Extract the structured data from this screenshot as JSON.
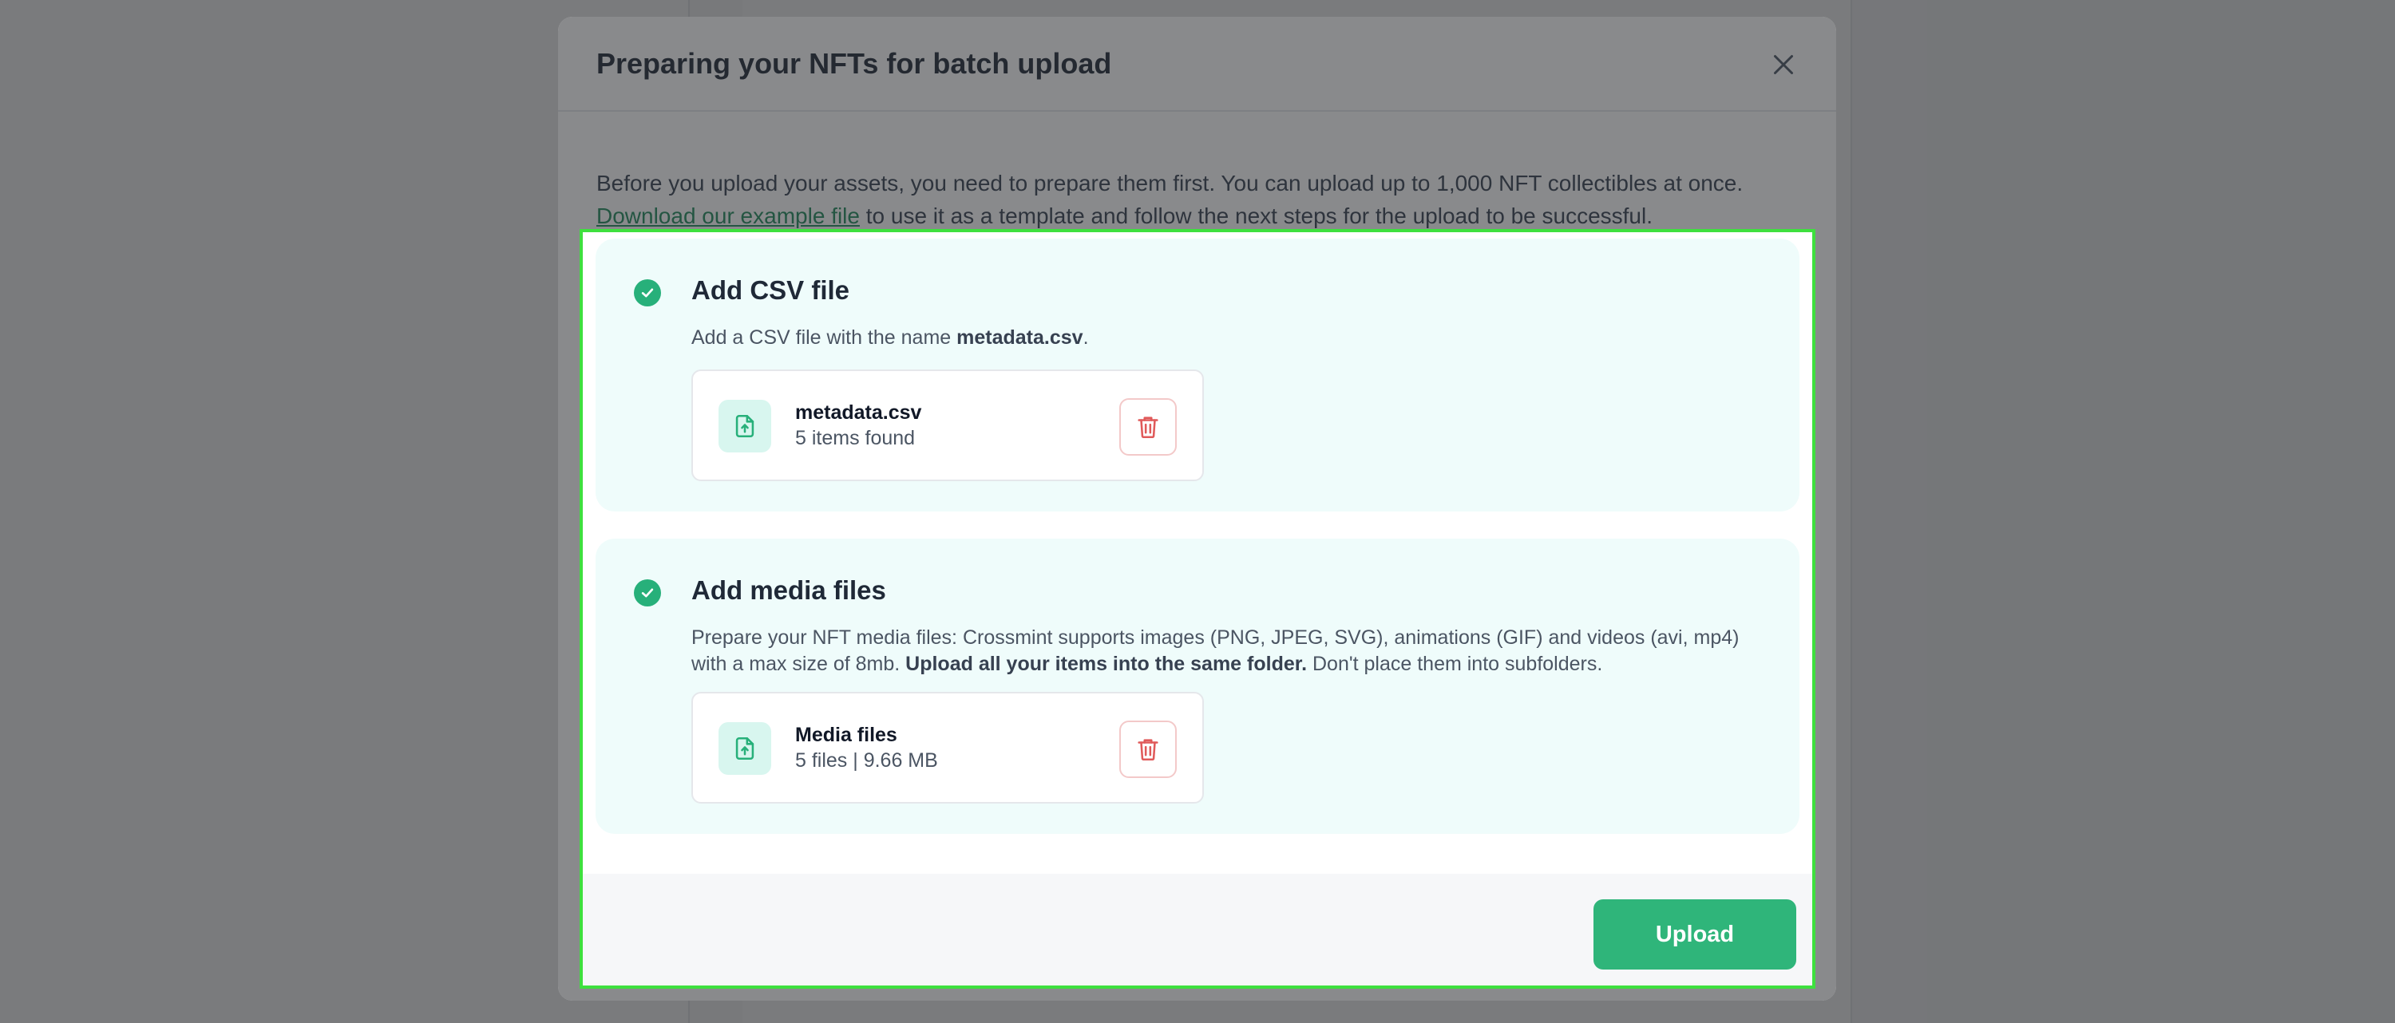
{
  "modal": {
    "title": "Preparing your NFTs for batch upload",
    "intro_before_link": "Before you upload your assets, you need to prepare them first. You can upload up to 1,000 NFT collectibles at once. ",
    "intro_link": "Download our example file",
    "intro_after_link": " to use it as a template and follow the next steps for the upload to be successful."
  },
  "steps": [
    {
      "title": "Add CSV file",
      "desc_before_bold": "Add a CSV file with the name ",
      "desc_bold": "metadata.csv",
      "desc_after_bold": ".",
      "file_name": "metadata.csv",
      "file_meta": "5 items found"
    },
    {
      "title": "Add media files",
      "desc_before_bold": "Prepare your NFT media files: Crossmint supports images (PNG, JPEG, SVG), animations (GIF) and videos (avi, mp4) with a max size of 8mb. ",
      "desc_bold": "Upload all your items into the same folder.",
      "desc_after_bold": " Don't place them into subfolders.",
      "file_name": "Media files",
      "file_meta": "5 files | 9.66 MB"
    }
  ],
  "footer": {
    "upload_label": "Upload"
  },
  "colors": {
    "accent": "#2fb57a",
    "check": "#27b07a",
    "step_bg": "#effcfb",
    "delete": "#e05a5a",
    "highlight": "#3ee03e"
  },
  "icons": {
    "close": "close-icon",
    "check": "check-circle-icon",
    "file": "file-upload-icon",
    "delete": "trash-icon"
  }
}
